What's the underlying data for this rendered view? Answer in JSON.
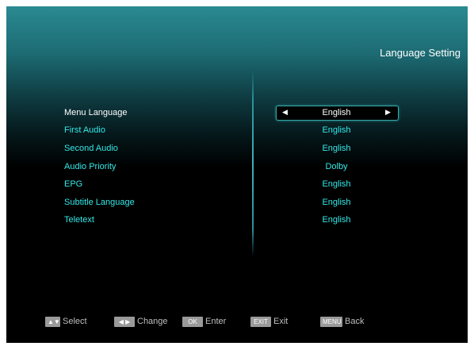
{
  "header": {
    "title": "Language Setting"
  },
  "settings": [
    {
      "label": "Menu Language",
      "value": "English"
    },
    {
      "label": "First Audio",
      "value": "English"
    },
    {
      "label": "Second Audio",
      "value": "English"
    },
    {
      "label": "Audio Priority",
      "value": "Dolby"
    },
    {
      "label": "EPG",
      "value": "English"
    },
    {
      "label": "Subtitle Language",
      "value": "English"
    },
    {
      "label": "Teletext",
      "value": "English"
    }
  ],
  "selected_index": 0,
  "footer": {
    "select": {
      "key": "▲▼",
      "label": "Select"
    },
    "change": {
      "key": "◀ ▶",
      "label": "Change"
    },
    "enter": {
      "key": "OK",
      "label": "Enter"
    },
    "exit": {
      "key": "EXIT",
      "label": "Exit"
    },
    "back": {
      "key": "MENU",
      "label": "Back"
    }
  },
  "colors": {
    "label": "#35e8e8",
    "selected": "#ffffff",
    "accent": "#2a8a92"
  },
  "icons": {
    "left": "left-arrow-icon",
    "right": "right-arrow-icon"
  }
}
